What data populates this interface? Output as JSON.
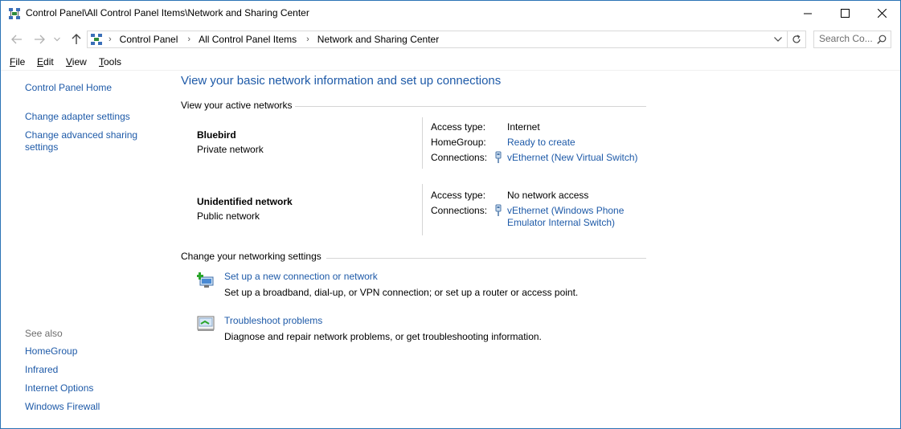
{
  "window": {
    "title": "Control Panel\\All Control Panel Items\\Network and Sharing Center",
    "controls": {
      "minimize": "minimize-icon",
      "maximize": "maximize-icon",
      "close": "close-icon"
    }
  },
  "navigation": {
    "breadcrumbs": [
      "Control Panel",
      "All Control Panel Items",
      "Network and Sharing Center"
    ],
    "search_placeholder": "Search Co..."
  },
  "menu": [
    {
      "label": "File",
      "accel": "F",
      "rest": "ile"
    },
    {
      "label": "Edit",
      "accel": "E",
      "rest": "dit"
    },
    {
      "label": "View",
      "accel": "V",
      "rest": "iew"
    },
    {
      "label": "Tools",
      "accel": "T",
      "rest": "ools"
    }
  ],
  "sidebar": {
    "home": "Control Panel Home",
    "links": [
      "Change adapter settings",
      "Change advanced sharing settings"
    ],
    "see_also_label": "See also",
    "see_also": [
      "HomeGroup",
      "Infrared",
      "Internet Options",
      "Windows Firewall"
    ]
  },
  "main": {
    "title": "View your basic network information and set up connections",
    "active_networks_heading": "View your active networks",
    "networks": [
      {
        "name": "Bluebird",
        "type": "Private network",
        "access_type_label": "Access type:",
        "access_type": "Internet",
        "homegroup_label": "HomeGroup:",
        "homegroup": "Ready to create",
        "connections_label": "Connections:",
        "connection": "vEthernet (New Virtual Switch)"
      },
      {
        "name": "Unidentified network",
        "type": "Public network",
        "access_type_label": "Access type:",
        "access_type": "No network access",
        "connections_label": "Connections:",
        "connection_line1": "vEthernet (Windows Phone",
        "connection_line2": "Emulator Internal Switch)"
      }
    ],
    "settings_heading": "Change your networking settings",
    "tasks": [
      {
        "link": "Set up a new connection or network",
        "description": "Set up a broadband, dial-up, or VPN connection; or set up a router or access point.",
        "icon": "new-connection-icon"
      },
      {
        "link": "Troubleshoot problems",
        "description": "Diagnose and repair network problems, or get troubleshooting information.",
        "icon": "troubleshoot-icon"
      }
    ]
  },
  "colors": {
    "link": "#1e5aa8",
    "border": "#2b73b6",
    "muted": "#6d6d6d"
  }
}
